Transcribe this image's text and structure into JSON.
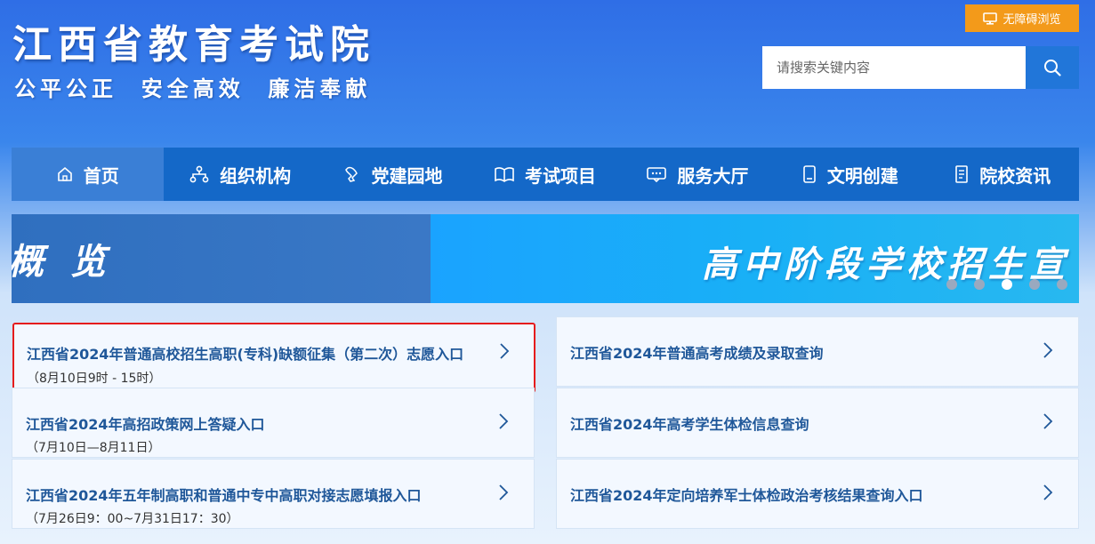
{
  "header": {
    "title": "江西省教育考试院",
    "slogan": "公平公正  安全高效  廉洁奉献",
    "accessibility_label": "无障碍浏览",
    "search_placeholder": "请搜索关键内容"
  },
  "nav": {
    "items": [
      {
        "label": "首页",
        "icon": "home-icon",
        "active": true
      },
      {
        "label": "组织机构",
        "icon": "org-chart-icon"
      },
      {
        "label": "党建园地",
        "icon": "party-building-icon"
      },
      {
        "label": "考试项目",
        "icon": "open-book-icon"
      },
      {
        "label": "服务大厅",
        "icon": "service-hall-icon"
      },
      {
        "label": "文明创建",
        "icon": "phone-icon"
      },
      {
        "label": "院校资讯",
        "icon": "document-icon"
      }
    ]
  },
  "banner": {
    "left_text": "概 览",
    "right_text": "高中阶段学校招生宣",
    "dots": 5,
    "active_dot": 3
  },
  "links": {
    "left": [
      {
        "title": "江西省2024年普通高校招生高职(专科)缺额征集（第二次）志愿入口",
        "subtitle": "（8月10日9时 - 15时）",
        "highlighted": true
      },
      {
        "title": "江西省2024年高招政策网上答疑入口",
        "subtitle": "（7月10日—8月11日）"
      },
      {
        "title": "江西省2024年五年制高职和普通中专中高职对接志愿填报入口",
        "subtitle": "（7月26日9：00~7月31日17：30）"
      }
    ],
    "right": [
      {
        "title": "江西省2024年普通高考成绩及录取查询"
      },
      {
        "title": "江西省2024年高考学生体检信息查询"
      },
      {
        "title": "江西省2024年定向培养军士体检政治考核结果查询入口"
      }
    ]
  },
  "colors": {
    "nav_bg": "#1468c8",
    "nav_active": "#3a7fd6",
    "accent_orange": "#f39a1a",
    "link_title": "#1f5799",
    "highlight_border": "#e51c1c"
  }
}
